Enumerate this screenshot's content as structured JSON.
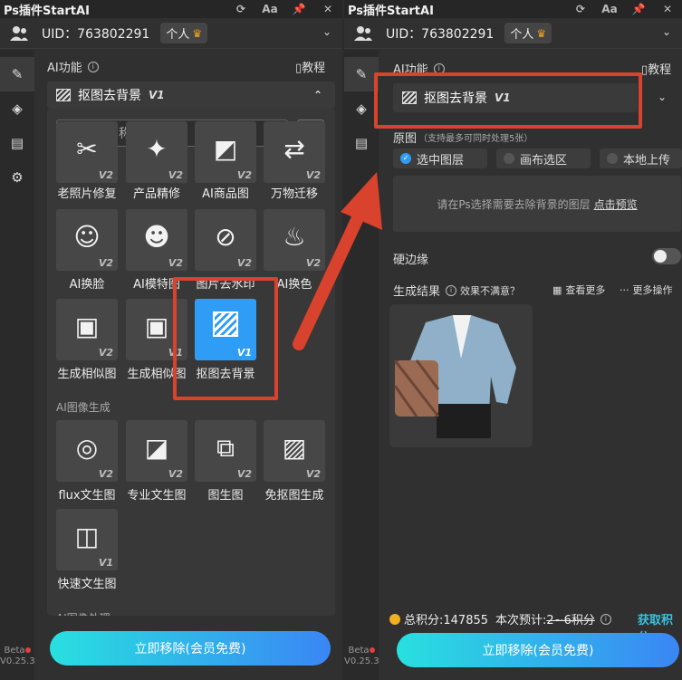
{
  "app_title": "Ps插件StartAI",
  "titlebar_icons": [
    "refresh-icon",
    "font-size-icon",
    "pin-icon",
    "close-icon"
  ],
  "titlebar_glyphs": {
    "font": "Aa",
    "close": "✕"
  },
  "uid_label": "UID：763802291",
  "account_badge": "个人",
  "ai_function_label": "AI功能",
  "tutorial_label": "教程",
  "selected_tool": {
    "name": "抠图去背景",
    "version": "V1"
  },
  "search_placeholder": "输入名称搜索",
  "tools": [
    {
      "label": "老照片修复",
      "version": "V2",
      "icon": "photo-restore-icon"
    },
    {
      "label": "产品精修",
      "version": "V2",
      "icon": "product-retouch-icon"
    },
    {
      "label": "AI商品图",
      "version": "V2",
      "icon": "product-image-icon"
    },
    {
      "label": "万物迁移",
      "version": "V2",
      "icon": "transfer-icon"
    },
    {
      "label": "AI换脸",
      "version": "V2",
      "icon": "face-swap-icon"
    },
    {
      "label": "AI模特图",
      "version": "V2",
      "icon": "model-icon"
    },
    {
      "label": "图片去水印",
      "version": "V2",
      "icon": "watermark-remove-icon"
    },
    {
      "label": "AI换色",
      "version": "V2",
      "icon": "recolor-icon"
    },
    {
      "label": "生成相似图",
      "version": "V2",
      "icon": "similar-image-icon"
    },
    {
      "label": "生成相似图",
      "version": "V1",
      "icon": "similar-image-icon"
    },
    {
      "label": "抠图去背景",
      "version": "V1",
      "icon": "cutout-icon"
    }
  ],
  "group_generation": "AI图像生成",
  "gen_tools": [
    {
      "label": "flux文生图",
      "version": "V2",
      "icon": "flux-icon"
    },
    {
      "label": "专业文生图",
      "version": "V2",
      "icon": "text-to-image-icon"
    },
    {
      "label": "图生图",
      "version": "V2",
      "icon": "image-to-image-icon"
    },
    {
      "label": "免抠图生成",
      "version": "V2",
      "icon": "no-cutout-icon"
    },
    {
      "label": "快速文生图",
      "version": "V1",
      "icon": "fast-text-image-icon"
    }
  ],
  "group_processing": "AI图像处理",
  "main_button": "立即移除(会员免费)",
  "version_tag": {
    "beta": "Beta",
    "number": "V0.25.3"
  },
  "source_label": "原图",
  "source_hint": "（支持最多可同时处理5张）",
  "source_options": [
    {
      "label": "选中图层",
      "selected": true
    },
    {
      "label": "画布选区",
      "selected": false
    },
    {
      "label": "本地上传",
      "selected": false
    }
  ],
  "preview_hint": "请在Ps选择需要去除背景的图层",
  "preview_link": "点击预览",
  "hard_edge_label": "硬边缘",
  "hard_edge_on": false,
  "result_label": "生成结果",
  "result_feedback": "效果不满意？",
  "view_more": "查看更多",
  "more_ops": "更多操作",
  "total_points": "总积分:147855",
  "estimate_label": "本次预计:",
  "estimate_value": "2~6积分",
  "get_points": "获取积分",
  "colors": {
    "accent": "#2f9df5",
    "highlight_box": "#d9422c",
    "gradient_start": "#28e0e0",
    "gradient_end": "#3a86f5"
  }
}
